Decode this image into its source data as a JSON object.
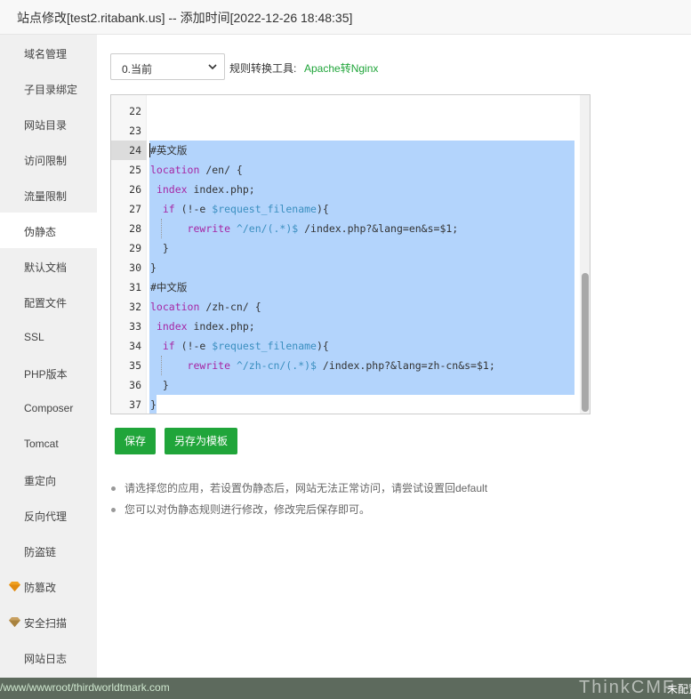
{
  "window": {
    "title": "站点修改[test2.ritabank.us] -- 添加时间[2022-12-26 18:48:35]"
  },
  "sidebar": {
    "items": [
      {
        "label": "域名管理"
      },
      {
        "label": "子目录绑定"
      },
      {
        "label": "网站目录"
      },
      {
        "label": "访问限制"
      },
      {
        "label": "流量限制"
      },
      {
        "label": "伪静态",
        "active": true
      },
      {
        "label": "默认文档"
      },
      {
        "label": "配置文件"
      },
      {
        "label": "SSL"
      },
      {
        "label": "PHP版本"
      },
      {
        "label": "Composer"
      },
      {
        "label": "Tomcat"
      },
      {
        "label": "重定向"
      },
      {
        "label": "反向代理"
      },
      {
        "label": "防盗链"
      },
      {
        "label": "防篡改",
        "icon": "gem-icon"
      },
      {
        "label": "安全扫描",
        "icon": "gem-icon"
      },
      {
        "label": "网站日志"
      }
    ]
  },
  "toolbar": {
    "select_value": "0.当前",
    "converter_label": "规则转换工具:",
    "converter_link": "Apache转Nginx"
  },
  "editor": {
    "lines": [
      {
        "num": "22",
        "code": ""
      },
      {
        "num": "23",
        "code": ""
      },
      {
        "num": "24",
        "code": "#英文版"
      },
      {
        "num": "25",
        "code": "location /en/ {"
      },
      {
        "num": "26",
        "code": " index index.php;"
      },
      {
        "num": "27",
        "code": "  if (!-e $request_filename){"
      },
      {
        "num": "28",
        "code": "      rewrite ^/en/(.*)$ /index.php?&lang=en&s=$1;"
      },
      {
        "num": "29",
        "code": "  }"
      },
      {
        "num": "30",
        "code": "}"
      },
      {
        "num": "31",
        "code": "#中文版"
      },
      {
        "num": "32",
        "code": "location /zh-cn/ {"
      },
      {
        "num": "33",
        "code": " index index.php;"
      },
      {
        "num": "34",
        "code": "  if (!-e $request_filename){"
      },
      {
        "num": "35",
        "code": "      rewrite ^/zh-cn/(.*)$ /index.php?&lang=zh-cn&s=$1;"
      },
      {
        "num": "36",
        "code": "  }"
      },
      {
        "num": "37",
        "code": "}"
      }
    ]
  },
  "buttons": {
    "save": "保存",
    "save_template": "另存为模板"
  },
  "tips": [
    "请选择您的应用，若设置伪静态后，网站无法正常访问，请尝试设置回default",
    "您可以对伪静态规则进行修改，修改完后保存即可。"
  ],
  "footer": {
    "path": "/www/wwwroot/thirdworldtmark.com",
    "watermark": "ThinkCMF",
    "right_text": "未配置"
  },
  "colors": {
    "accent": "#20a53a",
    "selection": "#b3d4fc",
    "keyword": "#a626a4",
    "variable": "#3b8fc0",
    "comment": "#2e8b57"
  }
}
